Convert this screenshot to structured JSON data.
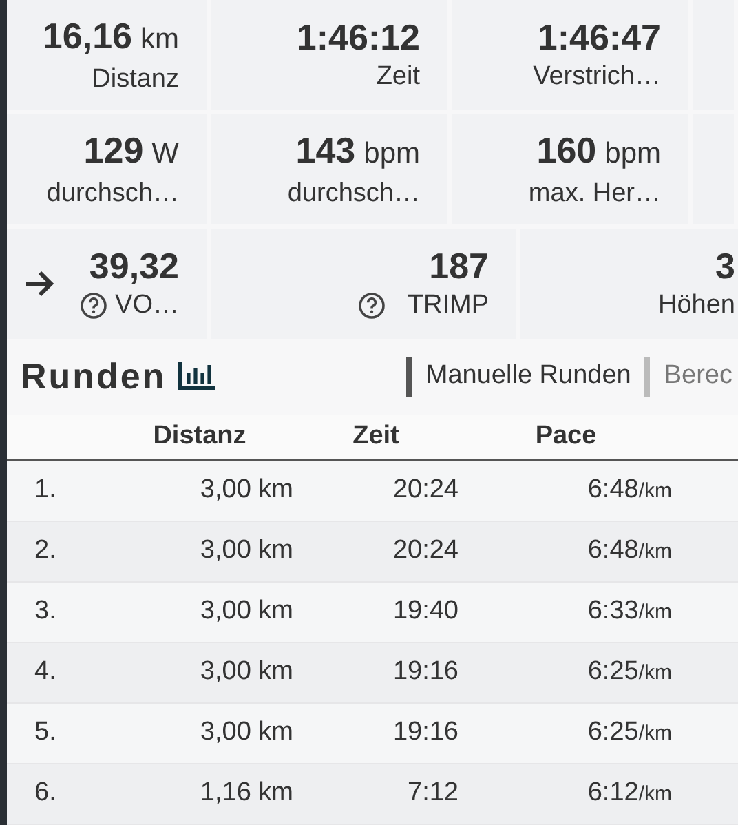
{
  "stats": [
    [
      {
        "value": "16,16",
        "unit": "km",
        "label": "Distanz"
      },
      {
        "value": "1:46:12",
        "label": "Zeit"
      },
      {
        "value": "1:46:47",
        "label": "Verstrich…"
      }
    ],
    [
      {
        "value": "129",
        "unit": "W",
        "label": "durchsch…"
      },
      {
        "value": "143",
        "unit": "bpm",
        "label": "durchsch…"
      },
      {
        "value": "160",
        "unit": "bpm",
        "label": "max. Her…"
      }
    ],
    [
      {
        "value": "39,32",
        "label": "VO…"
      },
      {
        "value": "187",
        "label": "TRIMP"
      },
      {
        "value": "3",
        "label": "Höhen"
      }
    ]
  ],
  "laps": {
    "title": "Runden",
    "tabs": [
      {
        "label": "Manuelle Runden",
        "selected": true
      },
      {
        "label": "Berec",
        "selected": false
      }
    ],
    "columns": [
      "Distanz",
      "Zeit",
      "Pace"
    ],
    "rows": [
      {
        "number": "1.",
        "distance": "3,00 km",
        "time": "20:24",
        "pace": "6:48",
        "pace_unit": "/km"
      },
      {
        "number": "2.",
        "distance": "3,00 km",
        "time": "20:24",
        "pace": "6:48",
        "pace_unit": "/km"
      },
      {
        "number": "3.",
        "distance": "3,00 km",
        "time": "19:40",
        "pace": "6:33",
        "pace_unit": "/km"
      },
      {
        "number": "4.",
        "distance": "3,00 km",
        "time": "19:16",
        "pace": "6:25",
        "pace_unit": "/km"
      },
      {
        "number": "5.",
        "distance": "3,00 km",
        "time": "19:16",
        "pace": "6:25",
        "pace_unit": "/km"
      },
      {
        "number": "6.",
        "distance": "1,16 km",
        "time": "7:12",
        "pace": "6:12",
        "pace_unit": "/km"
      }
    ]
  }
}
